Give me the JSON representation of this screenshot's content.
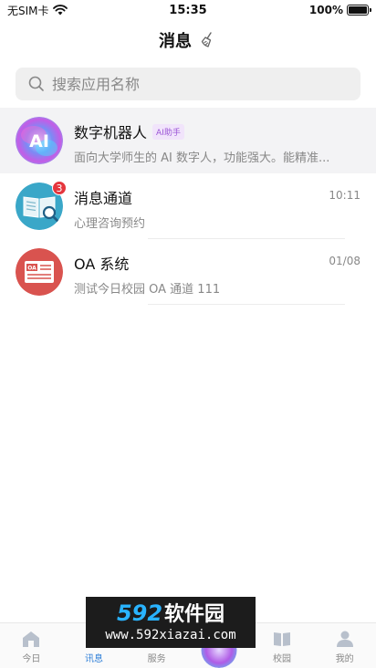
{
  "status": {
    "carrier": "无SIM卡",
    "time": "15:35",
    "battery": "100%"
  },
  "header": {
    "title": "消息",
    "clear_icon": "broom-icon"
  },
  "search": {
    "placeholder": "搜索应用名称",
    "icon": "search-icon"
  },
  "messages": [
    {
      "title": "数字机器人",
      "tag": "AI助手",
      "subtitle": "面向大学师生的 AI 数字人，功能强大。能精准...",
      "time": "",
      "badge": "",
      "icon": "ai-avatar-icon"
    },
    {
      "title": "消息通道",
      "tag": "",
      "subtitle": "心理咨询预约",
      "time": "10:11",
      "badge": "3",
      "icon": "book-search-icon"
    },
    {
      "title": "OA 系统",
      "tag": "",
      "subtitle": "测试今日校园 OA 通道 111",
      "time": "01/08",
      "badge": "",
      "icon": "oa-icon"
    }
  ],
  "tabs": [
    {
      "label": "今日",
      "icon": "home-icon",
      "active": false
    },
    {
      "label": "讯息",
      "icon": "message-icon",
      "active": true
    },
    {
      "label": "服务",
      "icon": "service-icon",
      "active": false
    },
    {
      "label": "",
      "icon": "ai-center-icon",
      "active": false
    },
    {
      "label": "校园",
      "icon": "book-icon",
      "active": false
    },
    {
      "label": "我的",
      "icon": "user-icon",
      "active": false
    }
  ],
  "watermark": {
    "number": "592",
    "name": "软件园",
    "url": "www.592xiazai.com"
  },
  "colors": {
    "accent": "#2f7fd8",
    "badge": "#e5363d",
    "tag_text": "#9b55d6",
    "tag_bg": "#f1e4fb",
    "highlight_row": "#f3f3f5"
  }
}
